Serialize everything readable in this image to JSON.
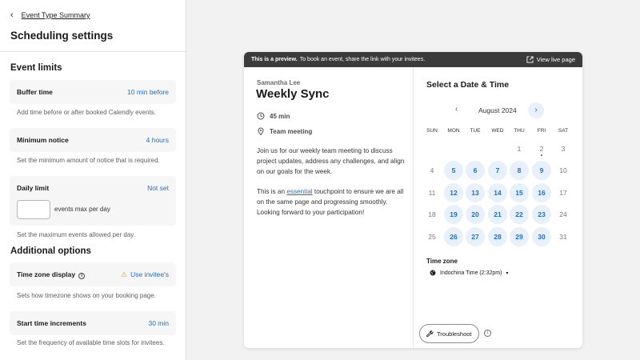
{
  "left": {
    "back_label": "Event Type Summary",
    "title": "Scheduling settings",
    "sections": {
      "limits_title": "Event limits",
      "options_title": "Additional options"
    },
    "buffer": {
      "label": "Buffer time",
      "value": "10 min before",
      "desc": "Add time before or after booked Calendly events."
    },
    "notice": {
      "label": "Minimum notice",
      "value": "4 hours",
      "desc": "Set the minimum amount of notice that is required."
    },
    "daily": {
      "label": "Daily limit",
      "value": "Not set",
      "input_value": "",
      "suffix": "events max per day",
      "desc": "Set the maximum events allowed per day."
    },
    "timezone": {
      "label": "Time zone display",
      "value": "Use invitee's",
      "desc": "Sets how timezone shows on your booking page."
    },
    "increments": {
      "label": "Start time increments",
      "value": "30 min",
      "desc": "Set the frequency of available time slots for invitees."
    }
  },
  "preview": {
    "banner_bold": "This is a preview.",
    "banner_text": "To book an event, share the link with your invitees.",
    "live_link": "View live page",
    "host": "Samantha Lee",
    "event_name": "Weekly Sync",
    "duration": "45 min",
    "location": "Team meeting",
    "desc1": "Join us for our weekly team meeting to discuss project updates, address any challenges, and align on our goals for the week.",
    "desc2_before": "This is an ",
    "desc2_link": "essential",
    "desc2_after": " touchpoint to ensure we are all on the same page and progressing smoothly. Looking forward to your participation!",
    "cal_title": "Select a Date & Time",
    "month": "August 2024",
    "weekdays": [
      "SUN",
      "MON",
      "TUE",
      "WED",
      "THU",
      "FRI",
      "SAT"
    ],
    "weeks": [
      [
        "",
        "",
        "",
        "",
        "1",
        "2",
        "3"
      ],
      [
        "4",
        "5",
        "6",
        "7",
        "8",
        "9",
        "10"
      ],
      [
        "11",
        "12",
        "13",
        "14",
        "15",
        "16",
        "17"
      ],
      [
        "18",
        "19",
        "20",
        "21",
        "22",
        "23",
        "24"
      ],
      [
        "25",
        "26",
        "27",
        "28",
        "29",
        "30",
        "31"
      ]
    ],
    "available_days": [
      "5",
      "6",
      "7",
      "8",
      "9",
      "12",
      "13",
      "14",
      "15",
      "16",
      "19",
      "20",
      "21",
      "22",
      "23",
      "26",
      "27",
      "28",
      "29",
      "30"
    ],
    "today": "2",
    "tz_label": "Time zone",
    "tz_value": "Indochina Time (2:32pm)",
    "troubleshoot": "Troubleshoot"
  },
  "colors": {
    "accent": "#1c6ed8",
    "available_bg": "#e8f0fc",
    "banner_bg": "#3b3b3b"
  }
}
